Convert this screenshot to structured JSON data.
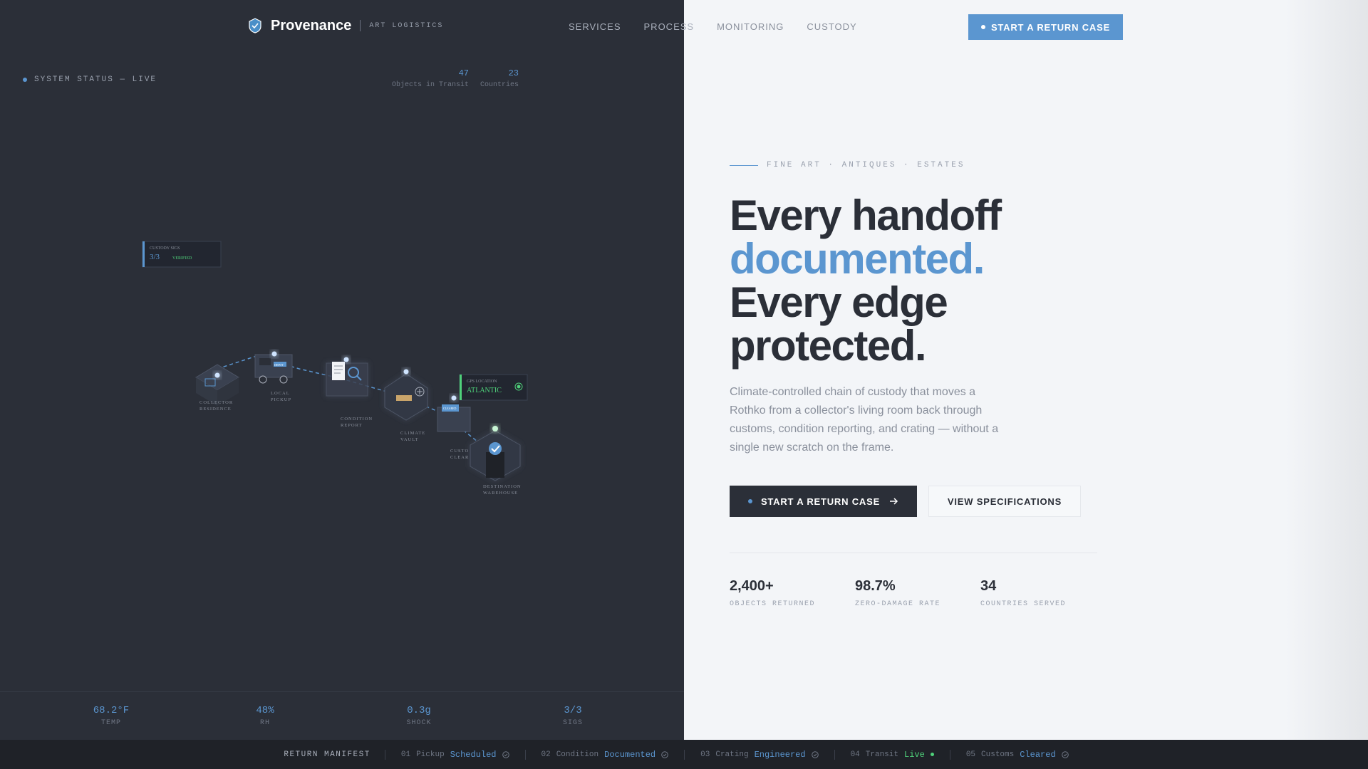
{
  "brand": {
    "name": "Provenance",
    "sub": "ART LOGISTICS"
  },
  "nav": {
    "items": [
      "SERVICES",
      "PROCESS",
      "MONITORING",
      "CUSTODY"
    ]
  },
  "header_cta": "START A RETURN CASE",
  "status": {
    "text": "SYSTEM STATUS — LIVE"
  },
  "kpis": [
    {
      "value": "47",
      "label": "Objects in Transit"
    },
    {
      "value": "23",
      "label": "Countries"
    }
  ],
  "diagram": {
    "custody_card": {
      "title": "CUSTODY SIGS",
      "value": "3/3",
      "badge": "VERIFIED"
    },
    "gps_card": {
      "title": "GPS LOCATION",
      "value": "ATLANTIC"
    },
    "nodes": [
      {
        "label": "COLLECTOR",
        "label2": "RESIDENCE"
      },
      {
        "label": "LOCAL",
        "label2": "PICKUP"
      },
      {
        "label": "CONDITION",
        "label2": "REPORT"
      },
      {
        "label": "CLIMATE",
        "label2": "VAULT"
      },
      {
        "label": "CUSTO",
        "label2": "CLEAR"
      },
      {
        "label": "DESTINATION",
        "label2": "WAREHOUSE"
      }
    ],
    "tags": {
      "truck": "DEPOT",
      "customs": "CLEARED"
    }
  },
  "sensors": [
    {
      "value": "68.2°F",
      "label": "TEMP"
    },
    {
      "value": "48%",
      "label": "RH"
    },
    {
      "value": "0.3g",
      "label": "SHOCK"
    },
    {
      "value": "3/3",
      "label": "SIGS"
    }
  ],
  "hero": {
    "eyebrow": "FINE ART · ANTIQUES · ESTATES",
    "line1": "Every handoff",
    "line2": "documented.",
    "line3": "Every edge",
    "line4": "protected.",
    "lede": "Climate-controlled chain of custody that moves a Rothko from a collector's living room back through customs, condition reporting, and crating — without a single new scratch on the frame.",
    "primary_label": "START A RETURN CASE",
    "secondary_label": "VIEW SPECIFICATIONS"
  },
  "stats": [
    {
      "value": "2,400+",
      "label": "OBJECTS RETURNED"
    },
    {
      "value": "98.7%",
      "label": "ZERO-DAMAGE RATE"
    },
    {
      "value": "34",
      "label": "COUNTRIES SERVED"
    }
  ],
  "manifest": {
    "title": "RETURN MANIFEST",
    "items": [
      {
        "num": "01",
        "label": "Pickup",
        "value": "Scheduled"
      },
      {
        "num": "02",
        "label": "Condition",
        "value": "Documented"
      },
      {
        "num": "03",
        "label": "Crating",
        "value": "Engineered"
      },
      {
        "num": "04",
        "label": "Transit",
        "value": "Live"
      },
      {
        "num": "05",
        "label": "Customs",
        "value": "Cleared"
      }
    ]
  },
  "colors": {
    "accent": "#5b96d0",
    "dark": "#2b2f38",
    "live": "#4fd17a"
  },
  "icons": [
    "shield-logo-icon",
    "arrow-right-icon",
    "check-circle-icon"
  ]
}
